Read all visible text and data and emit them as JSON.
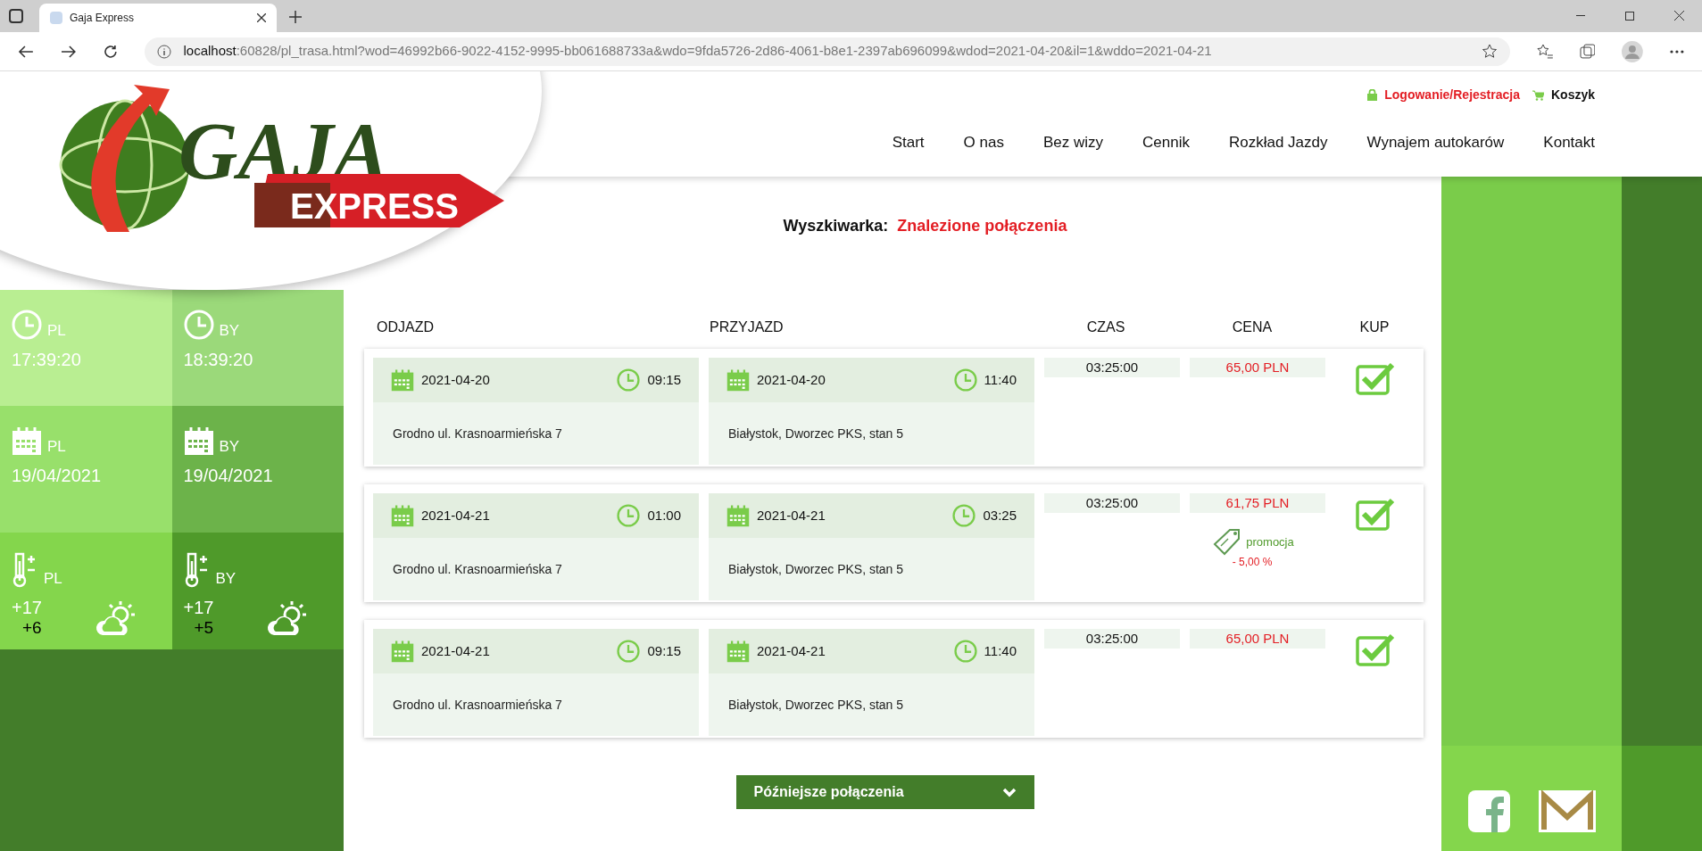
{
  "browser": {
    "tab_title": "Gaja Express",
    "url_host": "localhost",
    "url_path": ":60828/pl_trasa.html?wod=46992b66-9022-4152-9995-bb061688733a&wdo=9fda5726-2d86-4061-b8e1-2397ab696099&wdod=2021-04-20&il=1&wddo=2021-04-21"
  },
  "logo": {
    "script": "GAJA",
    "banner": "EXPRESS"
  },
  "top_links": [
    {
      "kind": "login",
      "label": "Logowanie/Rejestracja"
    },
    {
      "kind": "cart",
      "label": "Koszyk"
    }
  ],
  "nav": [
    "Start",
    "O nas",
    "Bez wizy",
    "Cennik",
    "Rozkład Jazdy",
    "Wynajem autokarów",
    "Kontakt"
  ],
  "tiles": [
    {
      "kind": "clock",
      "country": "PL",
      "value": "17:39:20"
    },
    {
      "kind": "clock",
      "country": "BY",
      "value": "18:39:20"
    },
    {
      "kind": "date",
      "country": "PL",
      "value": "19/04/2021"
    },
    {
      "kind": "date",
      "country": "BY",
      "value": "19/04/2021"
    },
    {
      "kind": "weather",
      "country": "PL",
      "value": "+17",
      "secondary": "+6"
    },
    {
      "kind": "weather",
      "country": "BY",
      "value": "+17",
      "secondary": "+5"
    }
  ],
  "search": {
    "label": "Wyszkiwarka:",
    "status": "Znalezione połączenia"
  },
  "columns": [
    "ODJAZD",
    "PRZYJAZD",
    "CZAS",
    "CENA",
    "KUP"
  ],
  "connections": [
    {
      "departure": {
        "date": "2021-04-20",
        "time": "09:15",
        "place": "Grodno ul. Krasnoarmieńska 7"
      },
      "arrival": {
        "date": "2021-04-20",
        "time": "11:40",
        "place": "Białystok, Dworzec PKS, stan 5"
      },
      "duration": "03:25:00",
      "price": "65,00 PLN"
    },
    {
      "departure": {
        "date": "2021-04-21",
        "time": "01:00",
        "place": "Grodno ul. Krasnoarmieńska 7"
      },
      "arrival": {
        "date": "2021-04-21",
        "time": "03:25",
        "place": "Białystok, Dworzec PKS, stan 5"
      },
      "duration": "03:25:00",
      "price": "61,75 PLN",
      "promotion": {
        "label": "promocja",
        "discount": "- 5,00 %"
      }
    },
    {
      "departure": {
        "date": "2021-04-21",
        "time": "09:15",
        "place": "Grodno ul. Krasnoarmieńska 7"
      },
      "arrival": {
        "date": "2021-04-21",
        "time": "11:40",
        "place": "Białystok, Dworzec PKS, stan 5"
      },
      "duration": "03:25:00",
      "price": "65,00 PLN"
    }
  ],
  "more_button": "Późniejsze połączenia"
}
